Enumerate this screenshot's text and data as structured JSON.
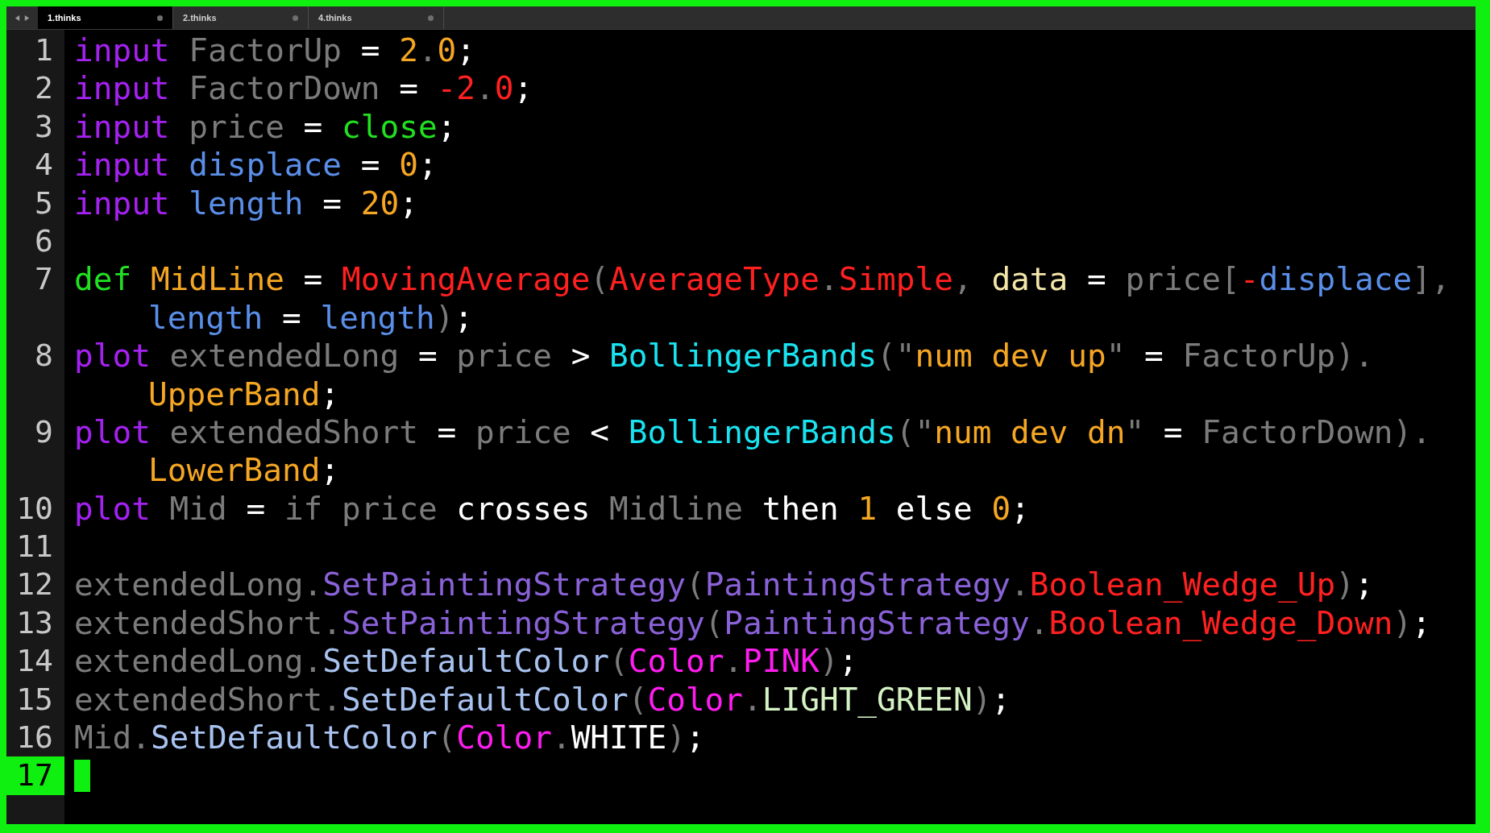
{
  "tabs": [
    {
      "label": "1.thinks",
      "selected": true
    },
    {
      "label": "2.thinks",
      "selected": false
    },
    {
      "label": "4.thinks",
      "selected": false
    }
  ],
  "lines": [
    {
      "number": "1",
      "current": false,
      "tokens": [
        {
          "text": "input",
          "color": "#a521f2"
        },
        {
          "text": " FactorUp",
          "color": "#7b7b7b"
        },
        {
          "text": " = ",
          "color": "#ffffff"
        },
        {
          "text": "2",
          "color": "#f5a623"
        },
        {
          "text": ".",
          "color": "#7b7b7b"
        },
        {
          "text": "0",
          "color": "#f5a623"
        },
        {
          "text": ";",
          "color": "#ffffff"
        }
      ]
    },
    {
      "number": "2",
      "current": false,
      "tokens": [
        {
          "text": "input",
          "color": "#a521f2"
        },
        {
          "text": " FactorDown",
          "color": "#7b7b7b"
        },
        {
          "text": " = ",
          "color": "#ffffff"
        },
        {
          "text": "-2",
          "color": "#ff2020"
        },
        {
          "text": ".",
          "color": "#7b7b7b"
        },
        {
          "text": "0",
          "color": "#ff2020"
        },
        {
          "text": ";",
          "color": "#ffffff"
        }
      ]
    },
    {
      "number": "3",
      "current": false,
      "tokens": [
        {
          "text": "input",
          "color": "#a521f2"
        },
        {
          "text": " price",
          "color": "#7b7b7b"
        },
        {
          "text": " = ",
          "color": "#ffffff"
        },
        {
          "text": "close",
          "color": "#21e021"
        },
        {
          "text": ";",
          "color": "#ffffff"
        }
      ]
    },
    {
      "number": "4",
      "current": false,
      "tokens": [
        {
          "text": "input",
          "color": "#a521f2"
        },
        {
          "text": " displace",
          "color": "#5a8ee8"
        },
        {
          "text": " = ",
          "color": "#ffffff"
        },
        {
          "text": "0",
          "color": "#f5a623"
        },
        {
          "text": ";",
          "color": "#ffffff"
        }
      ]
    },
    {
      "number": "5",
      "current": false,
      "tokens": [
        {
          "text": "input",
          "color": "#a521f2"
        },
        {
          "text": " length",
          "color": "#5a8ee8"
        },
        {
          "text": " = ",
          "color": "#ffffff"
        },
        {
          "text": "20",
          "color": "#f5a623"
        },
        {
          "text": ";",
          "color": "#ffffff"
        }
      ]
    },
    {
      "number": "6",
      "current": false
    },
    {
      "number": "7",
      "current": false,
      "tokens": [
        {
          "text": "def ",
          "color": "#21e021"
        },
        {
          "text": "MidLine",
          "color": "#f5a623"
        },
        {
          "text": " = ",
          "color": "#ffffff"
        },
        {
          "text": "MovingAverage",
          "color": "#ff2020"
        },
        {
          "text": "(",
          "color": "#7b7b7b"
        },
        {
          "text": "AverageType",
          "color": "#ff2020"
        },
        {
          "text": ".",
          "color": "#7b7b7b"
        },
        {
          "text": "Simple",
          "color": "#ff2020"
        },
        {
          "text": ", ",
          "color": "#7b7b7b"
        },
        {
          "text": "data",
          "color": "#f3e6a8"
        },
        {
          "text": " = ",
          "color": "#ffffff"
        },
        {
          "text": "price[",
          "color": "#7b7b7b"
        },
        {
          "text": "-",
          "color": "#ff2020"
        },
        {
          "text": "displace",
          "color": "#5a8ee8"
        },
        {
          "text": "],",
          "color": "#7b7b7b"
        }
      ],
      "wrapped": [
        {
          "text": "length",
          "color": "#5a8ee8"
        },
        {
          "text": " = ",
          "color": "#ffffff"
        },
        {
          "text": "length",
          "color": "#5a8ee8"
        },
        {
          "text": ")",
          "color": "#7b7b7b"
        },
        {
          "text": ";",
          "color": "#ffffff"
        }
      ]
    },
    {
      "number": "8",
      "current": false,
      "tokens": [
        {
          "text": "plot",
          "color": "#a521f2"
        },
        {
          "text": " extendedLong",
          "color": "#7b7b7b"
        },
        {
          "text": " = ",
          "color": "#ffffff"
        },
        {
          "text": "price",
          "color": "#7b7b7b"
        },
        {
          "text": " > ",
          "color": "#ffffff"
        },
        {
          "text": "BollingerBands",
          "color": "#19e3f0"
        },
        {
          "text": "(\"",
          "color": "#7b7b7b"
        },
        {
          "text": "num dev up",
          "color": "#f5a623"
        },
        {
          "text": "\"",
          "color": "#7b7b7b"
        },
        {
          "text": " = ",
          "color": "#ffffff"
        },
        {
          "text": "FactorUp).",
          "color": "#7b7b7b"
        }
      ],
      "wrapped": [
        {
          "text": "UpperBand",
          "color": "#f5a623"
        },
        {
          "text": ";",
          "color": "#ffffff"
        }
      ]
    },
    {
      "number": "9",
      "current": false,
      "tokens": [
        {
          "text": "plot",
          "color": "#a521f2"
        },
        {
          "text": " extendedShort",
          "color": "#7b7b7b"
        },
        {
          "text": " = ",
          "color": "#ffffff"
        },
        {
          "text": "price",
          "color": "#7b7b7b"
        },
        {
          "text": " < ",
          "color": "#ffffff"
        },
        {
          "text": "BollingerBands",
          "color": "#19e3f0"
        },
        {
          "text": "(\"",
          "color": "#7b7b7b"
        },
        {
          "text": "num dev dn",
          "color": "#f5a623"
        },
        {
          "text": "\"",
          "color": "#7b7b7b"
        },
        {
          "text": " = ",
          "color": "#ffffff"
        },
        {
          "text": "FactorDown).",
          "color": "#7b7b7b"
        }
      ],
      "wrapped": [
        {
          "text": "LowerBand",
          "color": "#f5a623"
        },
        {
          "text": ";",
          "color": "#ffffff"
        }
      ]
    },
    {
      "number": "10",
      "current": false,
      "tokens": [
        {
          "text": "plot",
          "color": "#a521f2"
        },
        {
          "text": " Mid",
          "color": "#7b7b7b"
        },
        {
          "text": " = ",
          "color": "#ffffff"
        },
        {
          "text": "if price",
          "color": "#7b7b7b"
        },
        {
          "text": " crosses ",
          "color": "#ffffff"
        },
        {
          "text": "Midline",
          "color": "#7b7b7b"
        },
        {
          "text": " then ",
          "color": "#ffffff"
        },
        {
          "text": "1",
          "color": "#f5a623"
        },
        {
          "text": " else ",
          "color": "#ffffff"
        },
        {
          "text": "0",
          "color": "#f5a623"
        },
        {
          "text": ";",
          "color": "#ffffff"
        }
      ]
    },
    {
      "number": "11",
      "current": false
    },
    {
      "number": "12",
      "current": false,
      "tokens": [
        {
          "text": "extendedLong.",
          "color": "#7b7b7b"
        },
        {
          "text": "SetPaintingStrategy",
          "color": "#8a62d8"
        },
        {
          "text": "(",
          "color": "#7b7b7b"
        },
        {
          "text": "PaintingStrategy",
          "color": "#8a62d8"
        },
        {
          "text": ".",
          "color": "#7b7b7b"
        },
        {
          "text": "Boolean_Wedge_Up",
          "color": "#ff2020"
        },
        {
          "text": ")",
          "color": "#7b7b7b"
        },
        {
          "text": ";",
          "color": "#ffffff"
        }
      ]
    },
    {
      "number": "13",
      "current": false,
      "tokens": [
        {
          "text": "extendedShort.",
          "color": "#7b7b7b"
        },
        {
          "text": "SetPaintingStrategy",
          "color": "#8a62d8"
        },
        {
          "text": "(",
          "color": "#7b7b7b"
        },
        {
          "text": "PaintingStrategy",
          "color": "#8a62d8"
        },
        {
          "text": ".",
          "color": "#7b7b7b"
        },
        {
          "text": "Boolean_Wedge_Down",
          "color": "#ff2020"
        },
        {
          "text": ")",
          "color": "#7b7b7b"
        },
        {
          "text": ";",
          "color": "#ffffff"
        }
      ]
    },
    {
      "number": "14",
      "current": false,
      "tokens": [
        {
          "text": "extendedLong.",
          "color": "#7b7b7b"
        },
        {
          "text": "SetDefaultColor",
          "color": "#a8c2f0"
        },
        {
          "text": "(",
          "color": "#7b7b7b"
        },
        {
          "text": "Color",
          "color": "#ff1cf0"
        },
        {
          "text": ".",
          "color": "#7b7b7b"
        },
        {
          "text": "PINK",
          "color": "#ff1cf0"
        },
        {
          "text": ")",
          "color": "#7b7b7b"
        },
        {
          "text": ";",
          "color": "#ffffff"
        }
      ]
    },
    {
      "number": "15",
      "current": false,
      "tokens": [
        {
          "text": "extendedShort.",
          "color": "#7b7b7b"
        },
        {
          "text": "SetDefaultColor",
          "color": "#a8c2f0"
        },
        {
          "text": "(",
          "color": "#7b7b7b"
        },
        {
          "text": "Color",
          "color": "#ff1cf0"
        },
        {
          "text": ".",
          "color": "#7b7b7b"
        },
        {
          "text": "LIGHT_GREEN",
          "color": "#d4f2c4"
        },
        {
          "text": ")",
          "color": "#7b7b7b"
        },
        {
          "text": ";",
          "color": "#ffffff"
        }
      ]
    },
    {
      "number": "16",
      "current": false,
      "tokens": [
        {
          "text": "Mid.",
          "color": "#7b7b7b"
        },
        {
          "text": "SetDefaultColor",
          "color": "#a8c2f0"
        },
        {
          "text": "(",
          "color": "#7b7b7b"
        },
        {
          "text": "Color",
          "color": "#ff1cf0"
        },
        {
          "text": ".",
          "color": "#7b7b7b"
        },
        {
          "text": "WHITE",
          "color": "#ffffff"
        },
        {
          "text": ")",
          "color": "#7b7b7b"
        },
        {
          "text": ";",
          "color": "#ffffff"
        }
      ]
    },
    {
      "number": "17",
      "current": true
    }
  ]
}
